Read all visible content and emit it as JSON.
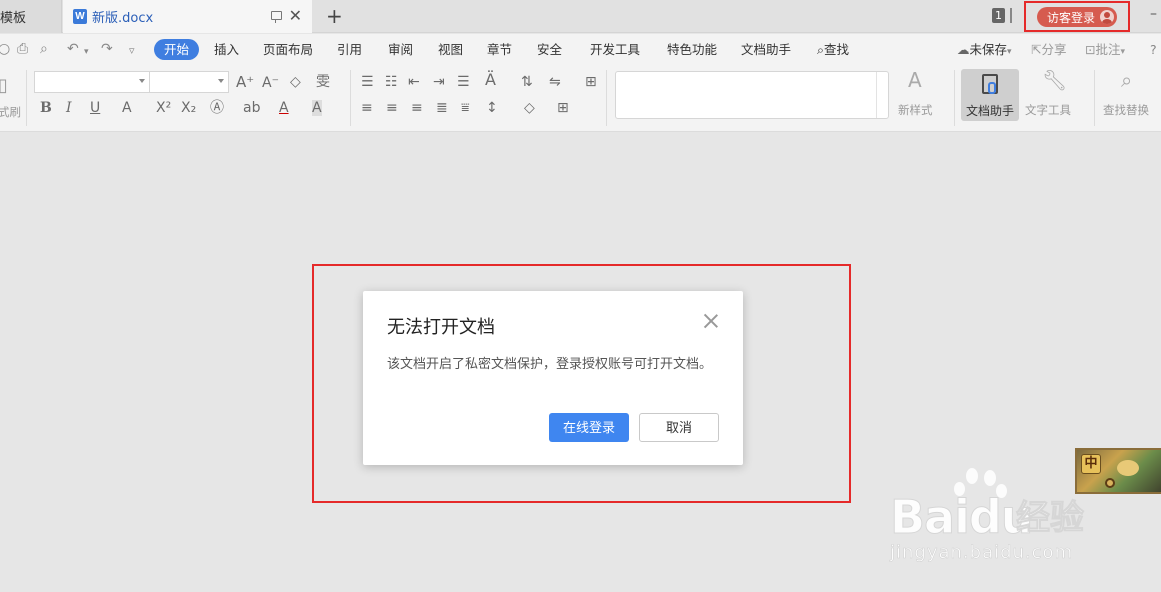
{
  "tabs": {
    "templates_label": "模板",
    "doc_label": "新版.docx",
    "doc_icon_letter": "W",
    "add_symbol": "+",
    "close_symbol": "✕"
  },
  "titlebar": {
    "window_count": "1",
    "login_label": "访客登录",
    "minimize": "–"
  },
  "menu": {
    "active": "开始",
    "items": [
      "插入",
      "页面布局",
      "引用",
      "审阅",
      "视图",
      "章节",
      "安全",
      "开发工具",
      "特色功能",
      "文档助手"
    ],
    "search_label": "查找",
    "unsaved_label": "未保存",
    "share_label": "分享",
    "comment_label": "批注"
  },
  "ribbon": {
    "format_painter_label": "式刷",
    "new_style_label": "新样式",
    "doc_helper_label": "文档助手",
    "text_tools_label": "文字工具",
    "find_replace_label": "查找替换"
  },
  "dialog": {
    "title": "无法打开文档",
    "message": "该文档开启了私密文档保护，登录授权账号可打开文档。",
    "primary_button": "在线登录",
    "secondary_button": "取消"
  },
  "widget": {
    "badge": "中"
  },
  "watermark": {
    "logo": "Baidu",
    "cn": "经验",
    "url": "jingyan.baidu.com"
  },
  "colors": {
    "accent": "#3f7ee0",
    "primary_button": "#3f86f0",
    "highlight_border": "#e52a2a",
    "login_pill": "#d65b4f"
  }
}
